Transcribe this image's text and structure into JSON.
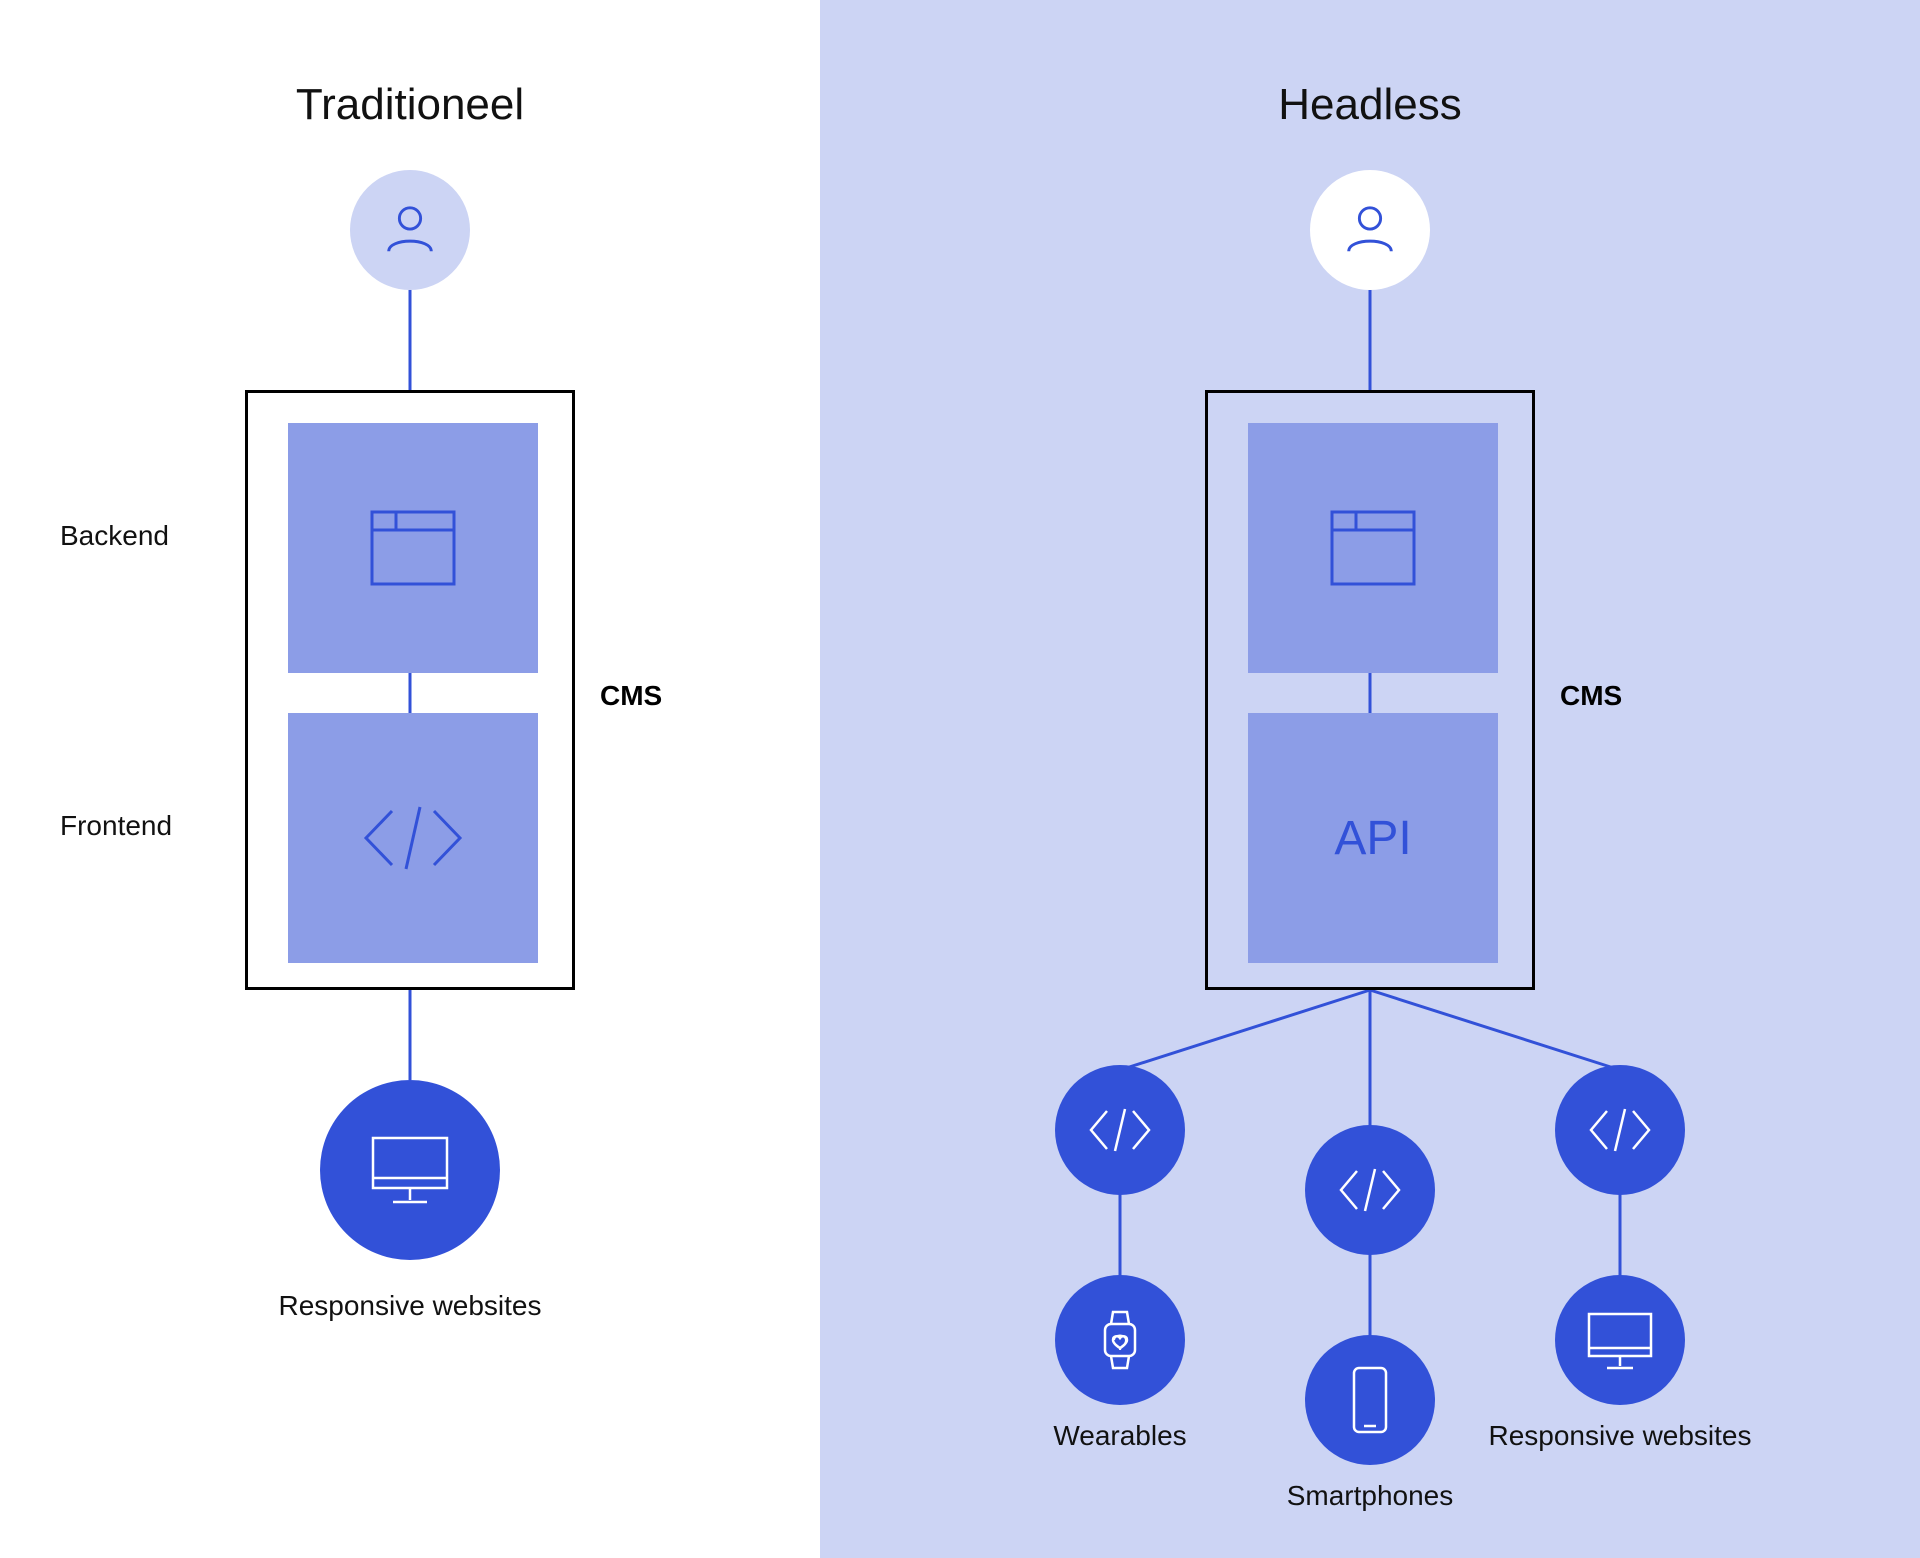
{
  "left": {
    "title": "Traditioneel",
    "backend_label": "Backend",
    "frontend_label": "Frontend",
    "cms_label": "CMS",
    "output_label": "Responsive websites"
  },
  "right": {
    "title": "Headless",
    "cms_label": "CMS",
    "api_label": "API",
    "outputs": {
      "wearables": "Wearables",
      "smartphones": "Smartphones",
      "responsive": "Responsive websites"
    }
  }
}
